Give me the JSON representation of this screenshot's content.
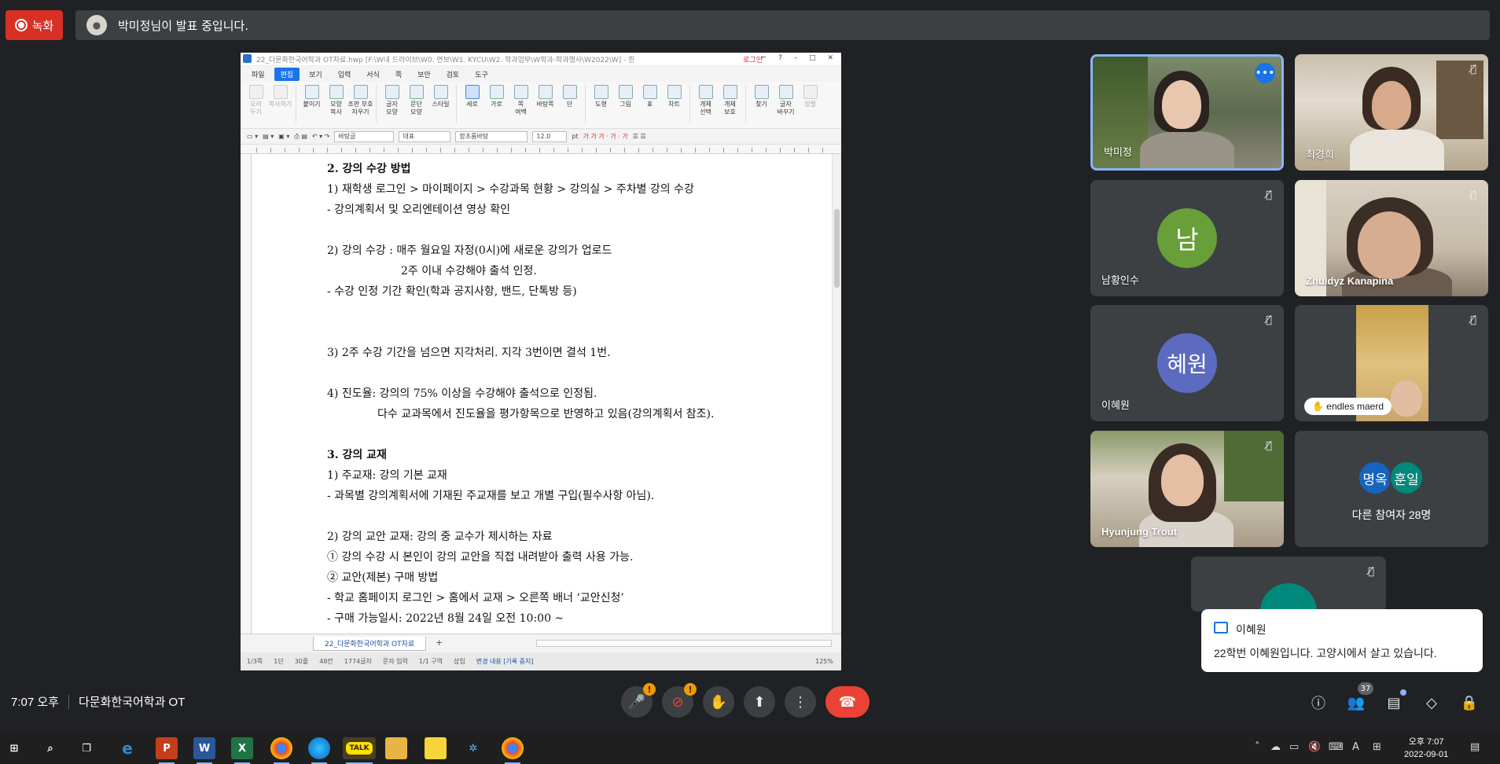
{
  "top": {
    "record_label": "녹화",
    "presenting_text": "박미정님이 발표 중입니다."
  },
  "hwp": {
    "window_title": "22_다문화한국어학과 OT자료.hwp [F:\\W내 드라이브\\W0. 연보\\W1. KYCU\\W2. 학과업무\\W학과-학과행사\\W2022\\W] - 한글",
    "login": "로그인",
    "menus": [
      "파일",
      "편집",
      "보기",
      "입력",
      "서식",
      "쪽",
      "보안",
      "검토",
      "도구"
    ],
    "selected_menu": "편집",
    "ribbon": [
      {
        "label": "오려\n두기",
        "state": "dim"
      },
      {
        "label": "복사하기",
        "state": "dim"
      },
      {
        "label": "붙이기",
        "state": ""
      },
      {
        "label": "모양\n복사",
        "state": ""
      },
      {
        "label": "조판 부호\n지우기",
        "state": ""
      },
      {
        "label": "글자\n모양",
        "state": ""
      },
      {
        "label": "문단\n모양",
        "state": ""
      },
      {
        "label": "스타일",
        "state": ""
      },
      {
        "label": "세로",
        "state": "on"
      },
      {
        "label": "가로",
        "state": ""
      },
      {
        "label": "쪽\n여백",
        "state": ""
      },
      {
        "label": "바탕쪽",
        "state": ""
      },
      {
        "label": "단",
        "state": ""
      },
      {
        "label": "도형",
        "state": ""
      },
      {
        "label": "그림",
        "state": ""
      },
      {
        "label": "표",
        "state": ""
      },
      {
        "label": "차트",
        "state": ""
      },
      {
        "label": "개체\n선택",
        "state": ""
      },
      {
        "label": "개체\n보호",
        "state": ""
      },
      {
        "label": "찾기",
        "state": ""
      },
      {
        "label": "글자\n바꾸기",
        "state": ""
      },
      {
        "label": "정렬",
        "state": "dim"
      }
    ],
    "format": {
      "style": "바탕글",
      "lang": "대표",
      "font": "함초롬바탕",
      "size": "12.0",
      "unit": "pt"
    },
    "doc_lines": [
      {
        "text": "2. 강의 수강 방법",
        "bold": true,
        "indent": 0
      },
      {
        "text": "1) 재학생 로그인 > 마이페이지 > 수강과목 현황 > 강의실 > 주차별 강의 수강",
        "bold": false,
        "indent": 0
      },
      {
        "text": "- 강의계획서 및 오리엔테이션 영상 확인",
        "bold": false,
        "indent": 0
      },
      {
        "text": "",
        "bold": false,
        "indent": 0
      },
      {
        "text": "2) 강의 수강 : 매주 월요일 자정(0시)에 새로운 강의가 업로드",
        "bold": false,
        "indent": 0
      },
      {
        "text": "2주 이내 수강해야 출석 인정.",
        "bold": false,
        "indent": 1
      },
      {
        "text": "- 수강 인정 기간 확인(학과 공지사항, 밴드, 단톡방 등)",
        "bold": false,
        "indent": 0
      },
      {
        "text": "",
        "bold": false,
        "indent": 0
      },
      {
        "text": "",
        "bold": false,
        "indent": 0
      },
      {
        "text": "3) 2주 수강 기간을 넘으면 지각처리. 지각 3번이면 결석 1번.",
        "bold": false,
        "indent": 0
      },
      {
        "text": "",
        "bold": false,
        "indent": 0
      },
      {
        "text": "4) 진도율: 강의의 75% 이상을 수강해야 출석으로 인정됨.",
        "bold": false,
        "indent": 0
      },
      {
        "text": "다수 교과목에서 진도율을 평가항목으로 반영하고 있음(강의계획서 참조).",
        "bold": false,
        "indent": 2
      },
      {
        "text": "",
        "bold": false,
        "indent": 0
      },
      {
        "text": "3. 강의 교재",
        "bold": true,
        "indent": 0
      },
      {
        "text": "1) 주교재: 강의 기본 교재",
        "bold": false,
        "indent": 0
      },
      {
        "text": "- 과목별 강의계획서에 기재된 주교재를 보고 개별 구입(필수사항 아님).",
        "bold": false,
        "indent": 0
      },
      {
        "text": "",
        "bold": false,
        "indent": 0
      },
      {
        "text": "2) 강의 교안 교재: 강의 중 교수가 제시하는 자료",
        "bold": false,
        "indent": 0
      },
      {
        "text": "① 강의 수강 시 본인이 강의 교안을 직접 내려받아 출력 사용 가능.",
        "bold": false,
        "indent": 0
      },
      {
        "text": "② 교안(제본) 구매 방법",
        "bold": false,
        "indent": 0
      },
      {
        "text": "- 학교 홈페이지 로그인 > 홈에서 교재 > 오른쪽 배너 ‘교안신청’",
        "bold": false,
        "indent": 0
      },
      {
        "text": "- 구매 가능일시: 2022년 8월 24일 오전 10:00 ~",
        "bold": false,
        "indent": 0
      }
    ],
    "tab_name": "22_다문화한국어학과 OT자료",
    "status": {
      "page": "1/3쪽",
      "section": "1단",
      "line": "30줄",
      "col": "48칸",
      "chars": "1774글자",
      "mode": "문자 입력",
      "area": "1/1 구역",
      "insert": "삽입",
      "track": "변경 내용 [기록 중지]",
      "zoom": "125%"
    }
  },
  "participants": [
    {
      "name": "박미정",
      "type": "video",
      "muted": false,
      "speaking": true
    },
    {
      "name": "최경희",
      "type": "video",
      "muted": true
    },
    {
      "name": "남황인수",
      "type": "avatar",
      "initial": "남",
      "color": "#689f38",
      "muted": true
    },
    {
      "name": "Zhuldyz Kanapina",
      "type": "video",
      "muted": true
    },
    {
      "name": "이혜원",
      "type": "avatar",
      "initial": "혜원",
      "color": "#5c6bc0",
      "muted": true
    },
    {
      "name": "endles maerd",
      "type": "video",
      "muted": true
    },
    {
      "name": "Hyunjung Trout",
      "type": "video",
      "muted": true
    },
    {
      "name": "다른 참여자 28명",
      "type": "group",
      "initials": [
        "명옥",
        "훈일"
      ],
      "colors": [
        "#1565c0",
        "#00897b"
      ]
    }
  ],
  "chat": {
    "sender": "이혜원",
    "message": "22학번 이혜원입니다. 고양시에서 살고 있습니다."
  },
  "meeting": {
    "time": "7:07 오후",
    "title": "다문화한국어학과 OT",
    "people_count": "37"
  },
  "taskbar": {
    "clock_time": "오후 7:07",
    "clock_date": "2022-09-01",
    "apps": [
      "start",
      "search",
      "task-view",
      "edge-legacy",
      "powerpoint",
      "word",
      "excel",
      "chrome",
      "edge",
      "kakaotalk",
      "explorer",
      "sticky-notes",
      "app",
      "chrome-2"
    ]
  }
}
